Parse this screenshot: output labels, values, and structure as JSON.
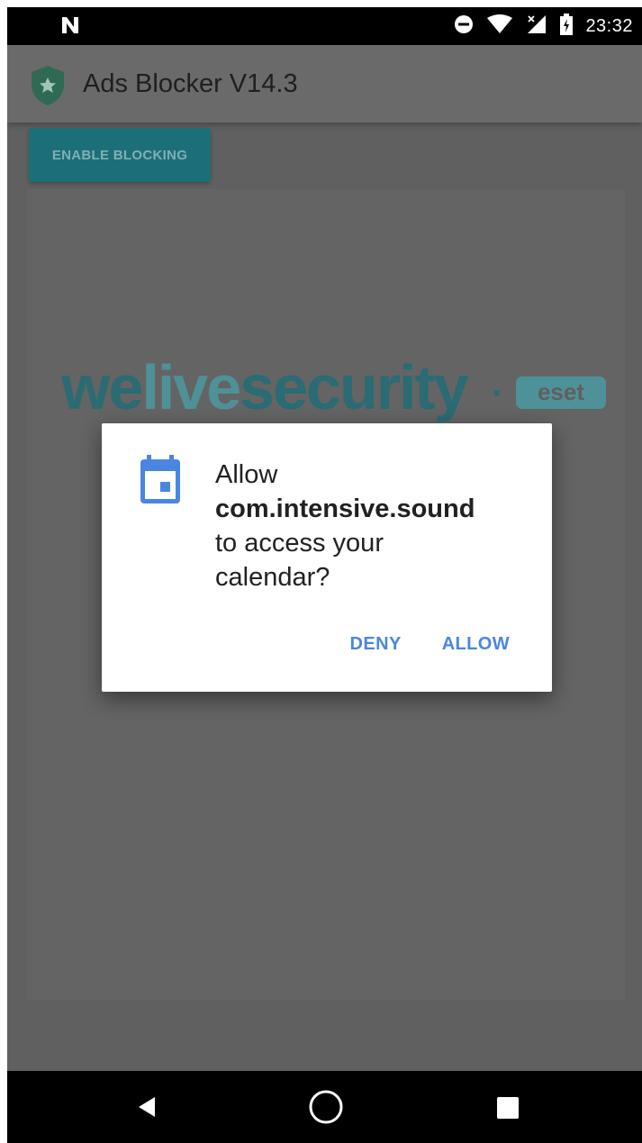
{
  "status_bar": {
    "time": "23:32",
    "icons": [
      "notification-n-icon",
      "do-not-disturb-icon",
      "wifi-icon",
      "signal-icon",
      "battery-icon"
    ]
  },
  "app_bar": {
    "title": "Ads Blocker V14.3",
    "logo_icon": "shield-star-icon"
  },
  "main": {
    "enable_button_label": "ENABLE BLOCKING"
  },
  "watermark": {
    "brand_part1": "we",
    "brand_part2": "live",
    "brand_part3": "security",
    "separator": "·",
    "eset_label": "eset"
  },
  "dialog": {
    "icon": "calendar-icon",
    "line1": "Allow",
    "package": "com.intensive.sound",
    "line3": "to access your",
    "line4": "calendar?",
    "deny_label": "DENY",
    "allow_label": "ALLOW"
  },
  "nav_bar": {
    "icons": [
      "back-icon",
      "home-icon",
      "recents-icon"
    ]
  },
  "colors": {
    "scrim": "#5f605f",
    "accent_blue": "#4a86e0",
    "teal_button": "#1c6f78",
    "watermark_teal": "#2a6b74",
    "watermark_light": "#4f9198",
    "shield_green": "#2f6a55"
  }
}
